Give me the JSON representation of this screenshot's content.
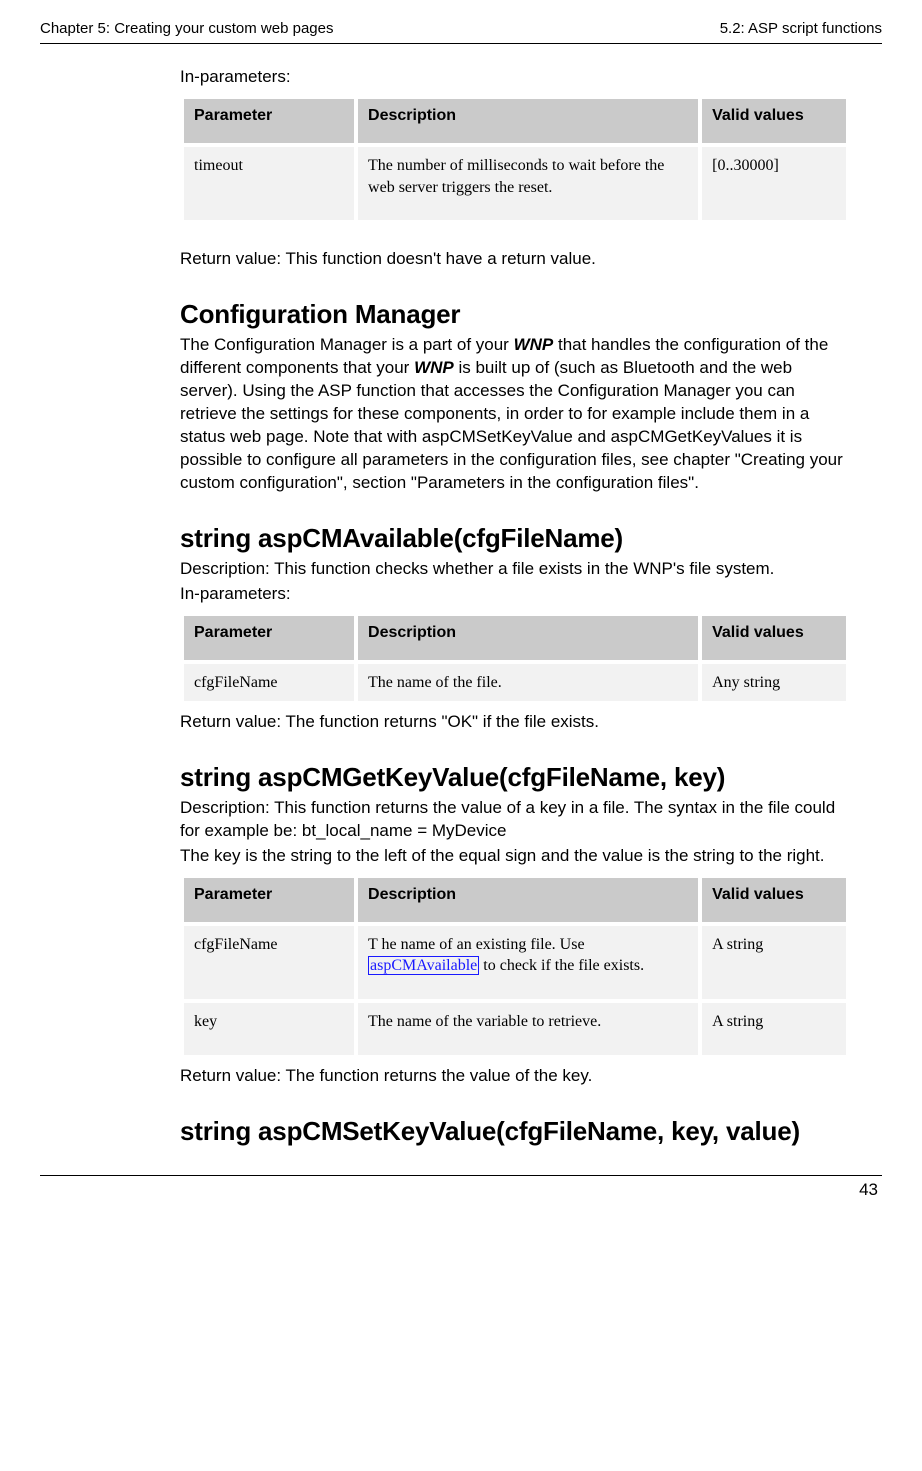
{
  "header": {
    "left": "Chapter 5: Creating your custom web pages",
    "right": "5.2: ASP script functions"
  },
  "sec1": {
    "in_params_label": "In-parameters:",
    "table": {
      "headers": {
        "p": "Parameter",
        "d": "Description",
        "v": "Valid values"
      },
      "rows": [
        {
          "p": "timeout",
          "d": "The number of milliseconds to wait before the web server triggers the reset.",
          "v": "[0..30000]"
        }
      ]
    },
    "return": "Return value: This function doesn't have a return value."
  },
  "cfgmgr": {
    "title": "Configuration Manager",
    "para_pre": "The Configuration Manager is a part of your ",
    "wnp": "WNP",
    "para_mid1": " that handles the configuration of the different components that your ",
    "para_mid2": " is built up of (such as Bluetooth and the web server). Using the ASP function that accesses the Configuration Manager you can retrieve the settings for these components, in order to for example include them in a status web page. Note that with aspCMSetKeyValue and aspCMGetKeyValues it is possible to configure all parameters in the configuration files, see chapter \"Creating your custom configuration\", section \"Parameters in the configuration files\"."
  },
  "avail": {
    "title": "string aspCMAvailable(cfgFileName)",
    "desc": "Description: This function checks whether a file exists in the WNP's file system.",
    "in_params_label": "In-parameters:",
    "table": {
      "headers": {
        "p": "Parameter",
        "d": "Description",
        "v": "Valid values"
      },
      "rows": [
        {
          "p": "cfgFileName",
          "d": "The name of the file.",
          "v": "Any string"
        }
      ]
    },
    "return": "Return value: The function returns \"OK\" if the file exists."
  },
  "getkv": {
    "title": "string aspCMGetKeyValue(cfgFileName, key)",
    "desc1": "Description: This function returns the value of a key in a file. The syntax in the file could for example be: bt_local_name = MyDevice",
    "desc2": "The key is the string to the left of the equal sign and the value is the string to the right.",
    "table": {
      "headers": {
        "p": "Parameter",
        "d": "Description",
        "v": "Valid values"
      },
      "rows": [
        {
          "p": "cfgFileName",
          "d_pre": "T he name of an existing file. Use ",
          "link": "aspCMAvailable",
          "d_post": " to check if the file exists.",
          "v": "A string"
        },
        {
          "p": "key",
          "d": "The name of the variable to retrieve.",
          "v": "A string"
        }
      ]
    },
    "return": "Return value: The function returns the value of the key."
  },
  "setkv": {
    "title": "string aspCMSetKeyValue(cfgFileName, key, value)"
  },
  "footer": {
    "page": "43"
  }
}
